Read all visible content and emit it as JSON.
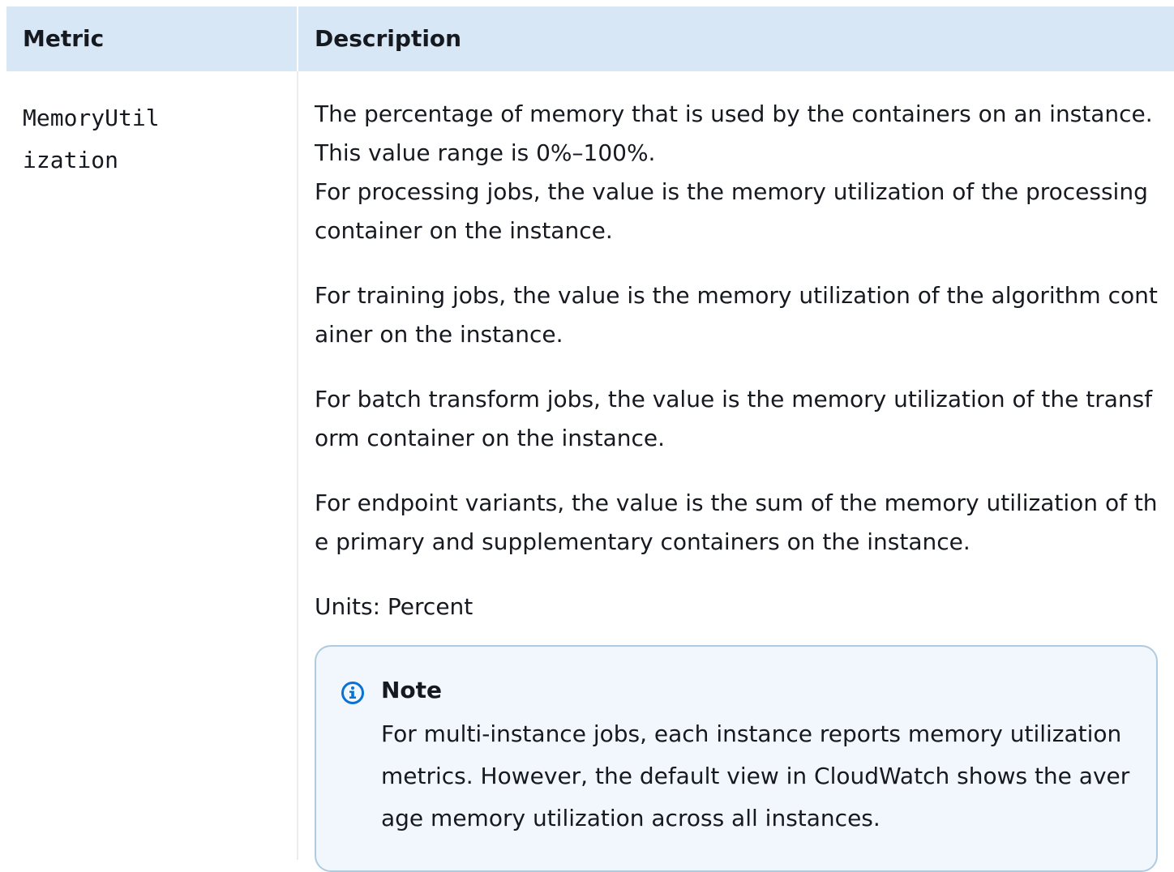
{
  "table": {
    "headers": {
      "metric": "Metric",
      "description": "Description"
    },
    "row": {
      "metric_name": "MemoryUtilization",
      "paragraphs": [
        "The percentage of memory that is used by the containers on an instance. This value range is 0%–100%.",
        "For processing jobs, the value is the memory utilization of the processing container on the instance.",
        "For training jobs, the value is the memory utilization of the algorithm container on the instance.",
        "For batch transform jobs, the value is the memory utilization of the transform container on the instance.",
        "For endpoint variants, the value is the sum of the memory utilization of the primary and supplementary containers on the instance.",
        "Units: Percent"
      ],
      "note": {
        "title": "Note",
        "text": "For multi-instance jobs, each instance reports memory utilization metrics. However, the default view in CloudWatch shows the average memory utilization across all instances.",
        "icon": "info-icon",
        "accent_color": "#0972d3"
      }
    }
  }
}
